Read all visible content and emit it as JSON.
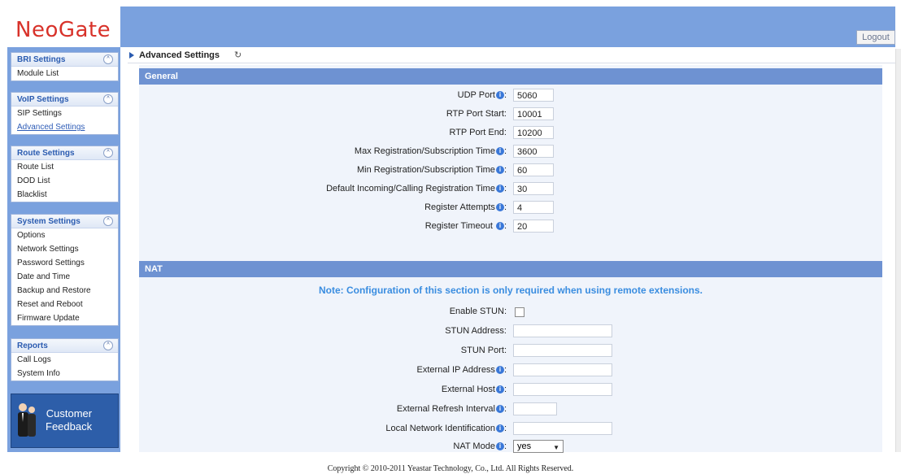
{
  "logo": "NeoGate",
  "logout": "Logout",
  "sidebar": {
    "groups": [
      {
        "title": "BRI Settings",
        "items": [
          "Module List"
        ]
      },
      {
        "title": "VoIP Settings",
        "items": [
          "SIP Settings",
          "Advanced Settings"
        ]
      },
      {
        "title": "Route Settings",
        "items": [
          "Route List",
          "DOD List",
          "Blacklist"
        ]
      },
      {
        "title": "System Settings",
        "items": [
          "Options",
          "Network Settings",
          "Password Settings",
          "Date and Time",
          "Backup and Restore",
          "Reset and Reboot",
          "Firmware Update"
        ]
      },
      {
        "title": "Reports",
        "items": [
          "Call Logs",
          "System Info"
        ]
      }
    ],
    "feedback_line1": "Customer",
    "feedback_line2": "Feedback"
  },
  "page": {
    "title": "Advanced Settings",
    "refresh_icon": "↻"
  },
  "sections": {
    "general": "General",
    "nat": "NAT"
  },
  "general": {
    "udp_port_label": "UDP Port",
    "udp_port": "5060",
    "rtp_start_label": "RTP Port Start:",
    "rtp_start": "10001",
    "rtp_end_label": "RTP Port End:",
    "rtp_end": "10200",
    "max_reg_label": "Max Registration/Subscription Time",
    "max_reg": "3600",
    "min_reg_label": "Min Registration/Subscription Time",
    "min_reg": "60",
    "default_reg_label": "Default Incoming/Calling Registration Time",
    "default_reg": "30",
    "reg_attempts_label": "Register Attempts",
    "reg_attempts": "4",
    "reg_timeout_label": "Register Timeout ",
    "reg_timeout": "20"
  },
  "nat": {
    "note": "Note: Configuration of this section is only required when using remote extensions.",
    "enable_stun_label": "Enable STUN:",
    "stun_address_label": "STUN Address:",
    "stun_port_label": "STUN Port:",
    "external_ip_label": "External IP Address",
    "external_host_label": "External Host",
    "external_refresh_label": "External Refresh Interval",
    "local_network_label": "Local Network Identification",
    "nat_mode_label": "NAT Mode",
    "nat_mode_value": "yes"
  },
  "copyright": "Copyright © 2010-2011 Yeastar Technology, Co., Ltd. All Rights Reserved."
}
